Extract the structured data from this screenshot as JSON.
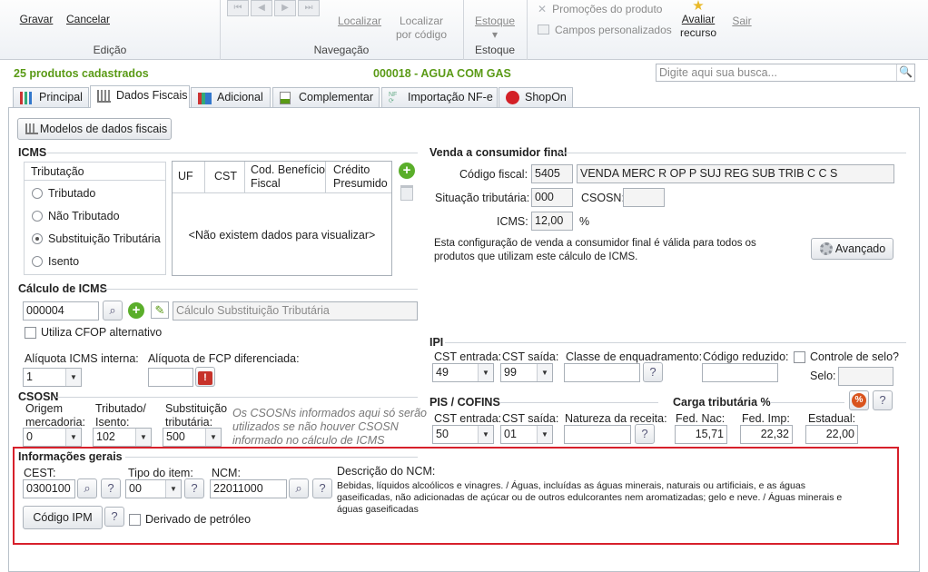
{
  "ribbon": {
    "gravar": "Gravar",
    "cancelar": "Cancelar",
    "group_edicao": "Edição",
    "localizar": "Localizar",
    "localizar_codigo_1": "Localizar",
    "localizar_codigo_2": "por código",
    "group_navegacao": "Navegação",
    "estoque": "Estoque",
    "estoque_arrow": "▾",
    "group_estoque": "Estoque",
    "promocoes": "Promoções do produto",
    "campos": "Campos personalizados",
    "avaliar_1": "Avaliar",
    "avaliar_2": "recurso",
    "sair": "Sair"
  },
  "infobar": {
    "count": "25 produtos cadastrados",
    "product": "000018 - AGUA COM GAS",
    "search_placeholder": "Digite aqui sua busca..."
  },
  "tabs": [
    "Principal",
    "Dados Fiscais",
    "Adicional",
    "Complementar",
    "Importação NF-e",
    "ShopOn"
  ],
  "modelos_button": "Modelos de dados fiscais",
  "icms": {
    "title": "ICMS",
    "tributacao_title": "Tributação",
    "options": [
      "Tributado",
      "Não Tributado",
      "Substituição Tributária",
      "Isento"
    ],
    "selected_index": 2,
    "table_headers": [
      "UF",
      "CST",
      "Cod. Benefício Fiscal",
      "Crédito Presumido"
    ],
    "table_empty": "<Não existem dados para visualizar>"
  },
  "venda": {
    "title": "Venda a consumidor final",
    "codigo_fiscal_label": "Código fiscal:",
    "codigo_fiscal": "5405",
    "codigo_fiscal_desc": "VENDA MERC R OP P SUJ REG SUB TRIB C C S",
    "situacao_label": "Situação tributária:",
    "situacao": "000",
    "csosn_label": "CSOSN:",
    "csosn": "",
    "icms_label": "ICMS:",
    "icms": "12,00",
    "percent": "%",
    "info_1": "Esta configuração de venda a consumidor final é válida para todos os",
    "info_2": "produtos que utilizam este cálculo de ICMS.",
    "avancado": "Avançado"
  },
  "calculo": {
    "title": "Cálculo de ICMS",
    "code": "000004",
    "desc": "Cálculo Substituição Tributária",
    "utiliza_cfop": "Utiliza CFOP alternativo",
    "aliquota_interna_label": "Alíquota ICMS interna:",
    "aliquota_interna": "1",
    "aliquota_fcp_label": "Alíquota de FCP diferenciada:",
    "aliquota_fcp": ""
  },
  "csosn": {
    "title": "CSOSN",
    "origem_label_1": "Origem",
    "origem_label_2": "mercadoria:",
    "origem": "0",
    "tributado_label_1": "Tributado/",
    "tributado_label_2": "Isento:",
    "tributado": "102",
    "subst_label_1": "Substituição",
    "subst_label_2": "tributária:",
    "subst": "500",
    "note_1": "Os CSOSNs informados aqui só serão",
    "note_2": "utilizados se não houver CSOSN",
    "note_3": "informado no cálculo de ICMS"
  },
  "ipi": {
    "title": "IPI",
    "cst_entrada_label": "CST entrada:",
    "cst_entrada": "49",
    "cst_saida_label": "CST saída:",
    "cst_saida": "99",
    "classe_label": "Classe de enquadramento:",
    "classe": "",
    "codigo_reduzido_label": "Código reduzido:",
    "codigo_reduzido": "",
    "controle_selo_label": "Controle de selo?",
    "selo_label": "Selo:",
    "selo": ""
  },
  "pis": {
    "title": "PIS / COFINS",
    "cst_entrada_label": "CST entrada:",
    "cst_entrada": "50",
    "cst_saida_label": "CST saída:",
    "cst_saida": "01",
    "natureza_label": "Natureza da receita:",
    "natureza": ""
  },
  "carga": {
    "title": "Carga tributária %",
    "fed_nac_label": "Fed. Nac:",
    "fed_nac": "15,71",
    "fed_imp_label": "Fed. Imp:",
    "fed_imp": "22,32",
    "estadual_label": "Estadual:",
    "estadual": "22,00"
  },
  "gerais": {
    "title": "Informações gerais",
    "cest_label": "CEST:",
    "cest": "0300100",
    "tipo_label": "Tipo do item:",
    "tipo": "00",
    "ncm_label": "NCM:",
    "ncm": "22011000",
    "descricao_label": "Descrição do NCM:",
    "descricao_1": "Bebidas, líquidos alcoólicos e vinagres. / Águas, incluídas as águas minerais, naturais ou artificiais, e as águas",
    "descricao_2": "gaseificadas, não adicionadas de açúcar ou de outros edulcorantes nem aromatizadas; gelo e neve. / Águas minerais e",
    "descricao_3": "águas gaseificadas",
    "codigo_ipm": "Código IPM",
    "derivado": "Derivado de petróleo"
  },
  "help": "?",
  "colors": {
    "green_text": "#5a9a16",
    "highlight_border": "#d7202b",
    "tab_border": "#b9c1ca"
  }
}
